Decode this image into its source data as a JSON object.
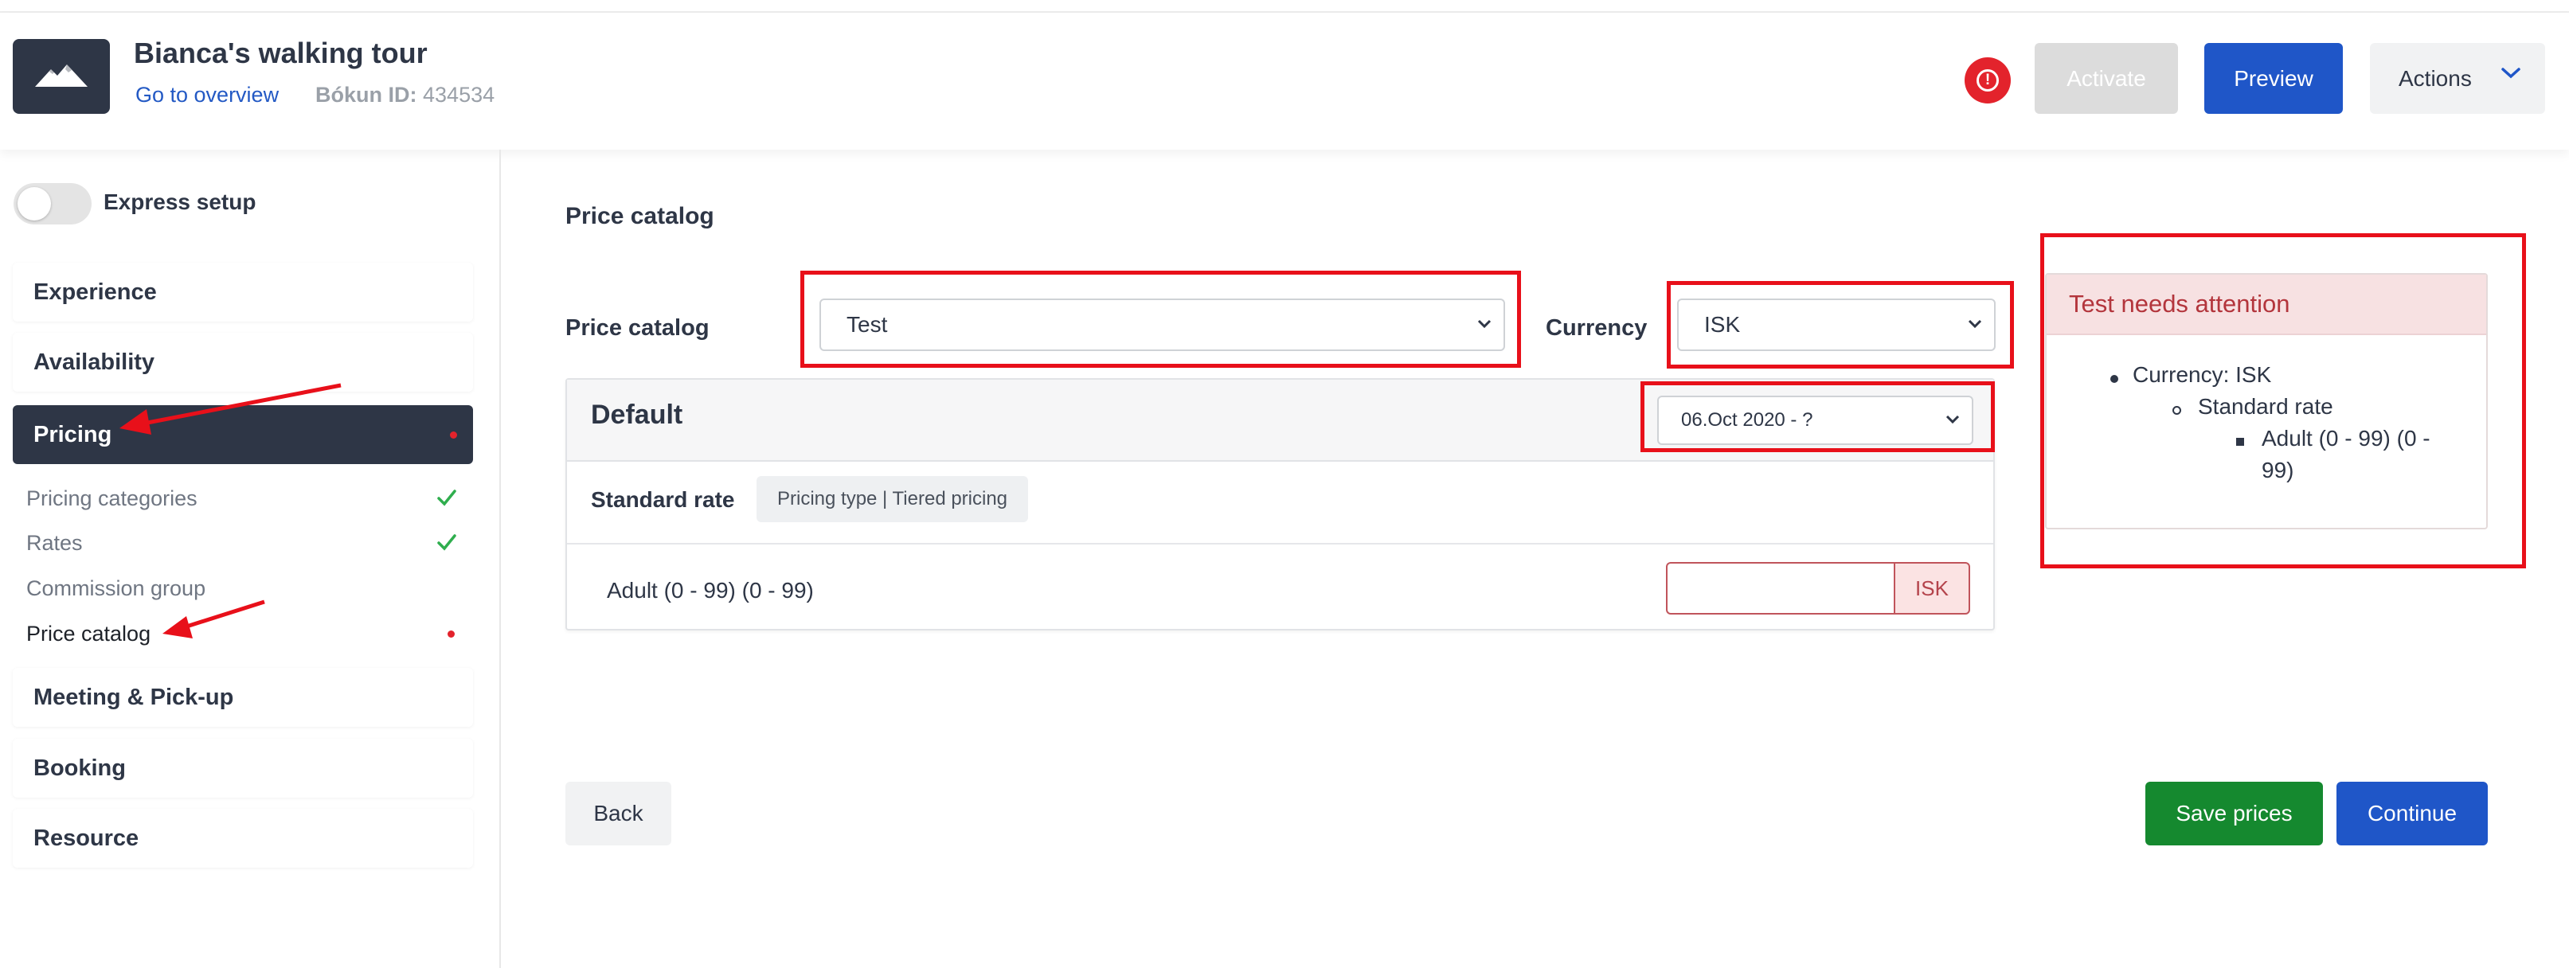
{
  "header": {
    "title": "Bianca's walking tour",
    "overview_link": "Go to overview",
    "bokun_id_label": "Bókun ID:",
    "bokun_id_value": "434534",
    "activate_label": "Activate",
    "preview_label": "Preview",
    "actions_label": "Actions"
  },
  "sidebar": {
    "express_setup_label": "Express setup",
    "express_setup_on": false,
    "items": [
      {
        "label": "Experience"
      },
      {
        "label": "Availability"
      },
      {
        "label": "Pricing",
        "active": true
      },
      {
        "label": "Meeting & Pick-up"
      },
      {
        "label": "Booking"
      },
      {
        "label": "Resource"
      }
    ],
    "pricing_sub": [
      {
        "label": "Pricing categories",
        "status": "complete"
      },
      {
        "label": "Rates",
        "status": "complete"
      },
      {
        "label": "Commission group",
        "status": "none"
      },
      {
        "label": "Price catalog",
        "status": "attention"
      }
    ]
  },
  "main": {
    "page_title": "Price catalog",
    "price_catalog_label": "Price catalog",
    "price_catalog_value": "Test",
    "currency_label": "Currency",
    "currency_value": "ISK",
    "card": {
      "title": "Default",
      "date_value": "06.Oct 2020 - ?",
      "rate_label": "Standard rate",
      "pricing_type_badge": "Pricing type | Tiered pricing",
      "category_label": "Adult (0 - 99) (0 - 99)",
      "price_value": "",
      "price_currency": "ISK"
    },
    "attention": {
      "title": "Test needs attention",
      "item_level1": "Currency: ISK",
      "item_level2": "Standard rate",
      "item_level3_line1": "Adult (0 - 99) (0 -",
      "item_level3_line2": "99)"
    },
    "back_label": "Back",
    "save_label": "Save prices",
    "continue_label": "Continue"
  },
  "colors": {
    "primary": "#1f56c8",
    "success": "#15892f",
    "sidebar_active": "#2e3646",
    "alert": "#e3232c",
    "annotation": "#e8101a"
  },
  "icons": {
    "logo": "mountain-icon",
    "alert": "exclamation-circle-icon",
    "dropdown": "chevron-down-icon",
    "complete": "check-icon"
  }
}
